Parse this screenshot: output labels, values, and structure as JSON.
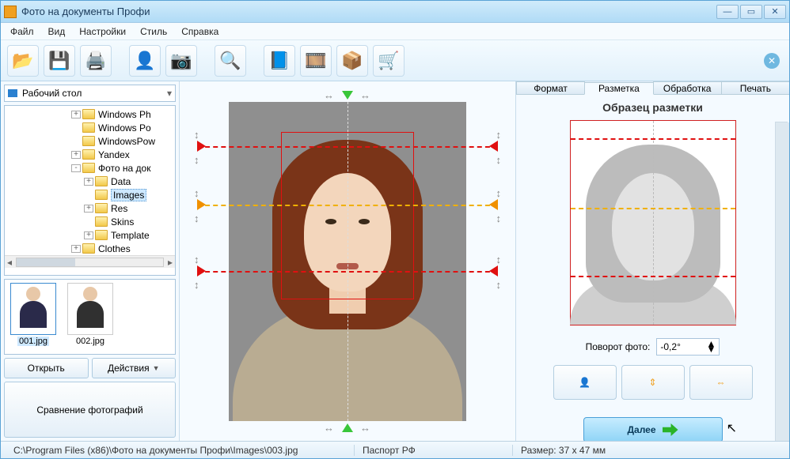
{
  "titlebar": {
    "title": "Фото на документы Профи"
  },
  "menu": {
    "file": "Файл",
    "view": "Вид",
    "settings": "Настройки",
    "style": "Стиль",
    "help": "Справка"
  },
  "left": {
    "combo": "Рабочий стол",
    "tree": [
      {
        "indent": 84,
        "exp": "+",
        "label": "Windows Ph"
      },
      {
        "indent": 84,
        "exp": "",
        "label": "Windows Po"
      },
      {
        "indent": 84,
        "exp": "",
        "label": "WindowsPow"
      },
      {
        "indent": 84,
        "exp": "+",
        "label": "Yandex"
      },
      {
        "indent": 84,
        "exp": "-",
        "label": "Фото на док"
      },
      {
        "indent": 100,
        "exp": "+",
        "label": "Data"
      },
      {
        "indent": 100,
        "exp": "",
        "label": "Images",
        "selected": true
      },
      {
        "indent": 100,
        "exp": "+",
        "label": "Res"
      },
      {
        "indent": 100,
        "exp": "",
        "label": "Skins"
      },
      {
        "indent": 100,
        "exp": "+",
        "label": "Template"
      },
      {
        "indent": 84,
        "exp": "+",
        "label": "Clothes"
      }
    ],
    "thumbs": [
      {
        "name": "001.jpg",
        "color": "#2a2a4a",
        "selected": true
      },
      {
        "name": "002.jpg",
        "color": "#303030",
        "selected": false
      }
    ],
    "open": "Открыть",
    "actions": "Действия",
    "compare": "Сравнение фотографий"
  },
  "right": {
    "tabs": {
      "format": "Формат",
      "markup": "Разметка",
      "process": "Обработка",
      "print": "Печать"
    },
    "sample_title": "Образец разметки",
    "rotate_label": "Поворот фото:",
    "rotate_value": "-0,2°",
    "next": "Далее"
  },
  "status": {
    "path": "C:\\Program Files (x86)\\Фото на документы Профи\\Images\\003.jpg",
    "doc": "Паспорт РФ",
    "size": "Размер: 37 x 47 мм"
  }
}
